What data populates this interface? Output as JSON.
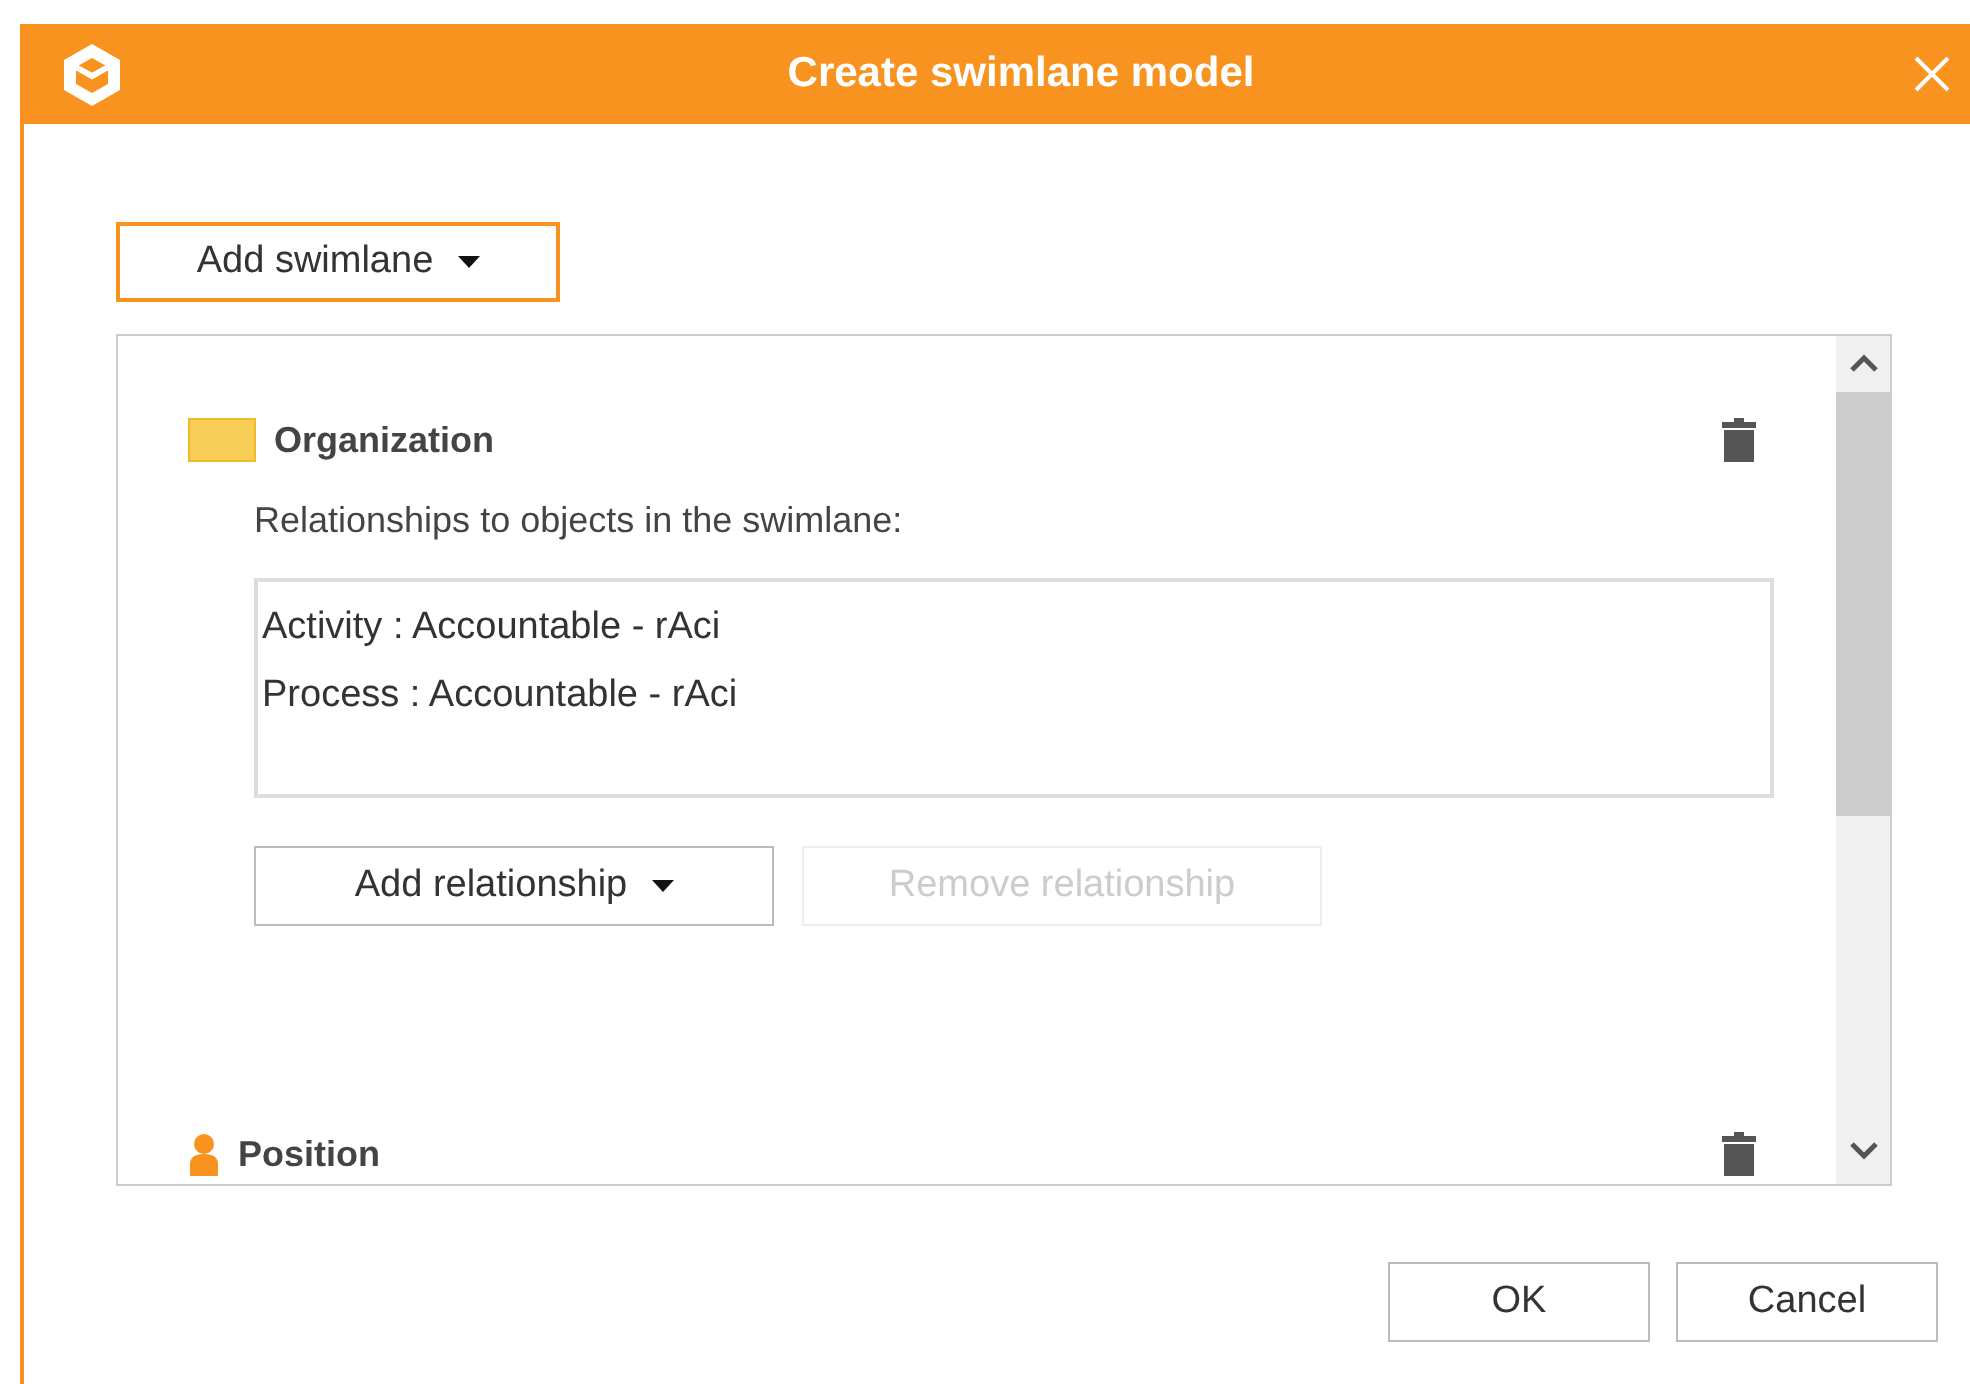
{
  "window": {
    "title": "Create swimlane model"
  },
  "add_swimlane_button": {
    "label": "Add swimlane"
  },
  "swimlanes": [
    {
      "kind": "organization",
      "name": "Organization",
      "relationships_label": "Relationships to objects in the swimlane:",
      "relationships": [
        "Activity : Accountable - rAci",
        "Process : Accountable - rAci"
      ],
      "buttons": [
        {
          "label": "Add relationship",
          "dropdown": true,
          "disabled": false
        },
        {
          "label": "Remove relationship",
          "dropdown": false,
          "disabled": true
        }
      ]
    },
    {
      "kind": "position",
      "name": "Position"
    }
  ],
  "footer_buttons": [
    "OK",
    "Cancel"
  ]
}
